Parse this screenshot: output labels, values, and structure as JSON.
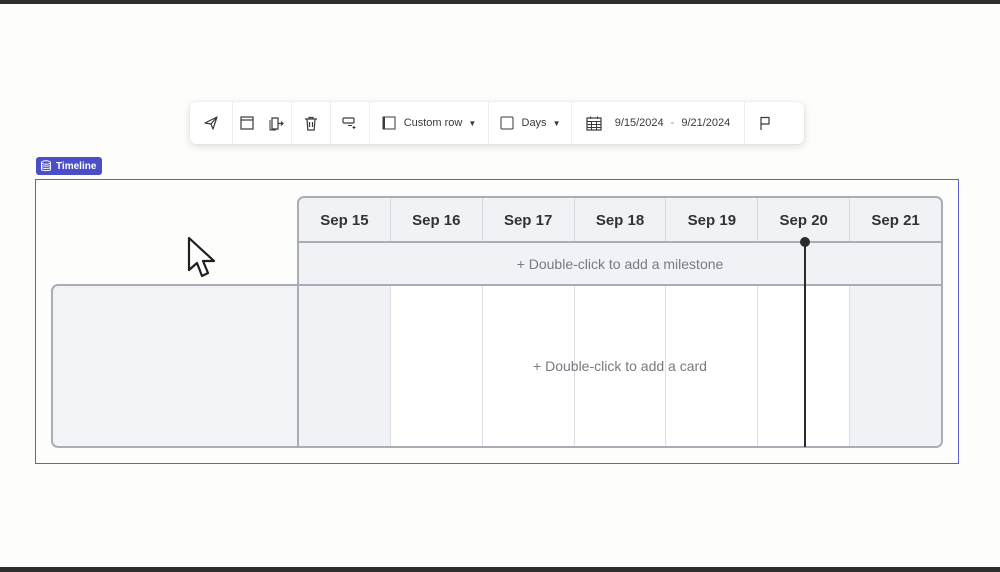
{
  "toolbar": {
    "row_type_label": "Custom row",
    "zoom_label": "Days",
    "date_start": "9/15/2024",
    "date_separator": "-",
    "date_end": "9/21/2024"
  },
  "timeline": {
    "badge_label": "Timeline",
    "days": [
      "Sep 15",
      "Sep 16",
      "Sep 17",
      "Sep 18",
      "Sep 19",
      "Sep 20",
      "Sep 21"
    ],
    "today": "Sep 20",
    "milestone_hint": "+ Double-click to add a milestone",
    "card_hint": "+ Double-click to add a card"
  },
  "colors": {
    "accent": "#4a4fc7",
    "grid_border": "#a9adb6",
    "weekend_fill": "#f1f2f5",
    "today_marker": "#2b2b2b"
  },
  "icons": [
    "send-icon",
    "frame-icon",
    "export-icon",
    "trash-icon",
    "row-add-icon",
    "row-type-icon",
    "zoom-icon",
    "calendar-icon",
    "flag-icon",
    "database-icon",
    "pointer-cursor-icon"
  ]
}
